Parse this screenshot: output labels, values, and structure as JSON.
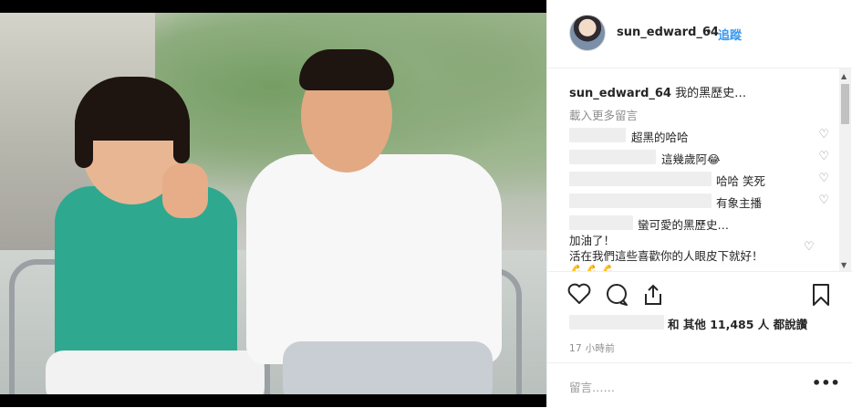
{
  "post": {
    "username": "sun_edward_64",
    "dot": "•",
    "follow_label": "追蹤"
  },
  "caption": {
    "username": "sun_edward_64",
    "text": "我的黑歷史…"
  },
  "load_more": "載入更多留言",
  "comments": [
    {
      "text": "超黑的哈哈"
    },
    {
      "text": "這幾歲阿😂"
    },
    {
      "text": "哈哈 笑死"
    },
    {
      "text": "有象主播"
    },
    {
      "text": "蠻可愛的黑歷史…"
    }
  ],
  "comment_multiline": {
    "line1": "加油了！",
    "line2": "活在我們這些喜歡你的人眼皮下就好！",
    "emojis": "💪💪💪"
  },
  "likes": {
    "text": "和 其他 11,485 人 都說讚"
  },
  "timestamp": "17 小時前",
  "add_comment": {
    "placeholder": "留言……",
    "more": "•••"
  },
  "icons": {
    "heart": "heart-icon",
    "comment": "comment-icon",
    "share": "share-icon",
    "bookmark": "bookmark-icon"
  },
  "colors": {
    "accent": "#3897f0",
    "muted": "#8e8e8e",
    "border": "#efefef"
  }
}
